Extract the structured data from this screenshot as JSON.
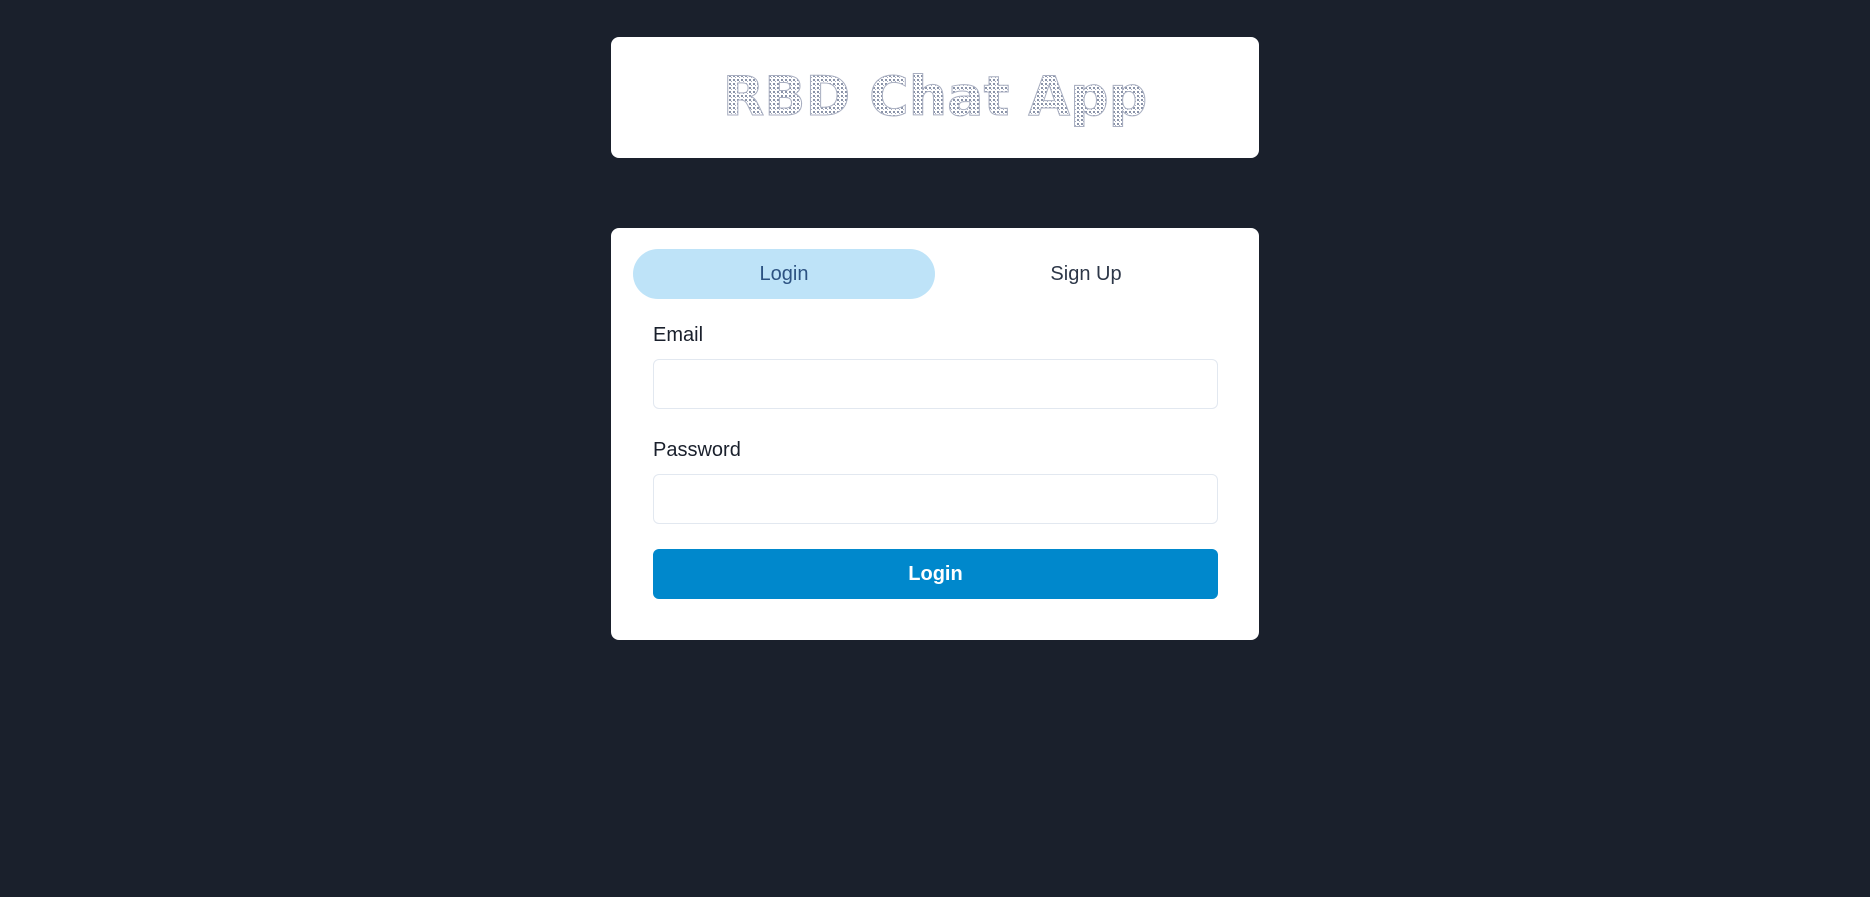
{
  "header": {
    "logo_text": "RBD Chat App"
  },
  "tabs": [
    {
      "label": "Login",
      "active": true
    },
    {
      "label": "Sign Up",
      "active": false
    }
  ],
  "form": {
    "email_label": "Email",
    "email_value": "",
    "password_label": "Password",
    "password_value": "",
    "submit_label": "Login"
  },
  "colors": {
    "background": "#1a202c",
    "card": "#ffffff",
    "tab_active_bg": "#bee3f8",
    "tab_active_text": "#2c5282",
    "button": "#0088cc",
    "logo_fill": "#8a93a8"
  }
}
